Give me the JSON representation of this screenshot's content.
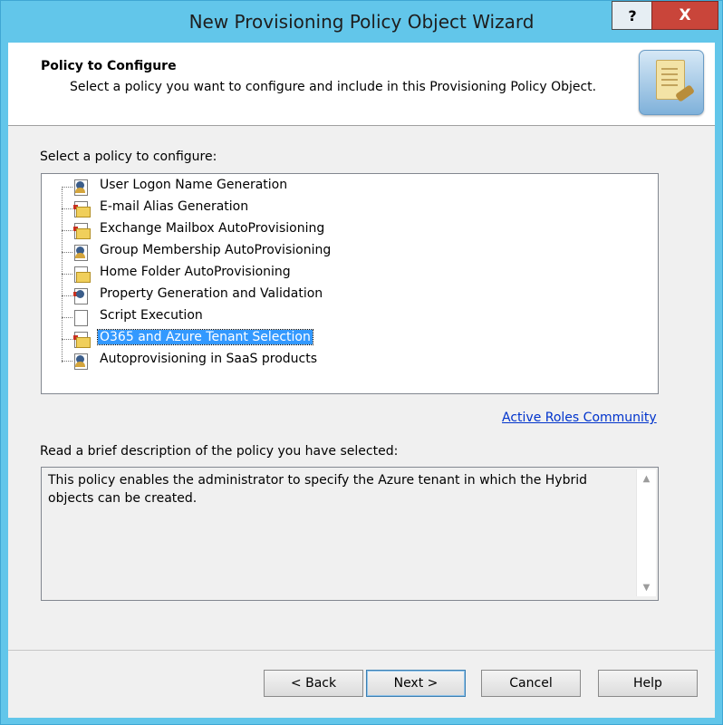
{
  "window": {
    "title": "New Provisioning Policy Object Wizard",
    "help_label": "?",
    "close_label": "X"
  },
  "header": {
    "title": "Policy to Configure",
    "subtitle": "Select a policy you want to configure and include in this Provisioning Policy Object.",
    "icon": "policy-scroll-icon"
  },
  "policy_list": {
    "label": "Select a policy to configure:",
    "items": [
      {
        "label": "User Logon Name Generation",
        "icon": "user-doc-icon"
      },
      {
        "label": "E-mail Alias Generation",
        "icon": "mail-doc-icon"
      },
      {
        "label": "Exchange Mailbox AutoProvisioning",
        "icon": "mailbox-doc-icon"
      },
      {
        "label": "Group Membership AutoProvisioning",
        "icon": "group-doc-icon"
      },
      {
        "label": "Home Folder AutoProvisioning",
        "icon": "folder-doc-icon"
      },
      {
        "label": "Property Generation and Validation",
        "icon": "property-doc-icon"
      },
      {
        "label": "Script Execution",
        "icon": "script-doc-icon"
      },
      {
        "label": "O365 and Azure Tenant Selection",
        "icon": "tenant-doc-icon",
        "selected": true
      },
      {
        "label": "Autoprovisioning in SaaS products",
        "icon": "saas-doc-icon"
      }
    ]
  },
  "community_link": "Active Roles Community",
  "description": {
    "label": "Read a brief description of the policy you have selected:",
    "text": "This policy enables the administrator to specify the Azure tenant in which the Hybrid objects can be created."
  },
  "buttons": {
    "back": "< Back",
    "next": "Next >",
    "cancel": "Cancel",
    "help": "Help"
  },
  "colors": {
    "chrome": "#62c6ea",
    "close": "#c9453a",
    "selection": "#3399ff",
    "link": "#0033cc"
  }
}
